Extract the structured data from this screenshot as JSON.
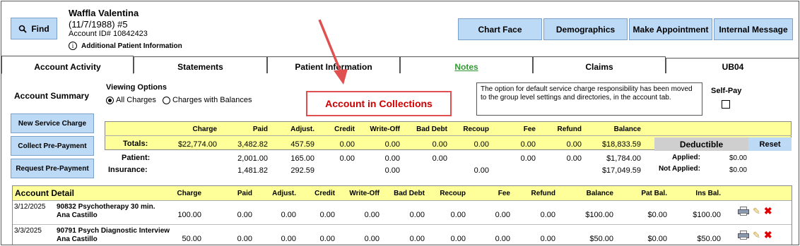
{
  "find_label": "Find",
  "patient": {
    "name": "Waffla Valentina",
    "dob_line": "(11/7/1988) #5",
    "account_id": "Account ID# 10842423",
    "additional_info": "Additional Patient Information"
  },
  "top_buttons": [
    "Chart Face",
    "Demographics",
    "Make Appointment",
    "Internal Message"
  ],
  "tabs": [
    "Account Activity",
    "Statements",
    "Patient Information",
    "Notes",
    "Claims",
    "UB04"
  ],
  "account_summary": "Account Summary",
  "viewing_options": {
    "title": "Viewing Options",
    "opt1": "All Charges",
    "opt2": "Charges with Balances",
    "selected": "All Charges"
  },
  "collections_banner": "Account in Collections",
  "notice": "The option for default service charge responsibility has been moved to the group level settings and directories, in the account tab.",
  "self_pay": "Self-Pay",
  "side_buttons": [
    "New Service Charge",
    "Collect Pre-Payment",
    "Request Pre-Payment"
  ],
  "summary": {
    "headers": [
      "Charge",
      "Paid",
      "Adjust.",
      "Credit",
      "Write-Off",
      "Bad Debt",
      "Recoup",
      "Fee",
      "Refund",
      "Balance"
    ],
    "totals_label": "Totals:",
    "totals": [
      "$22,774.00",
      "3,482.82",
      "457.59",
      "0.00",
      "0.00",
      "0.00",
      "0.00",
      "0.00",
      "0.00",
      "$18,833.59"
    ],
    "patient_label": "Patient:",
    "patient": [
      "",
      "2,001.00",
      "165.00",
      "0.00",
      "0.00",
      "0.00",
      "",
      "0.00",
      "0.00",
      "$1,784.00"
    ],
    "insurance_label": "Insurance:",
    "insurance": [
      "",
      "1,481.82",
      "292.59",
      "",
      "0.00",
      "",
      "0.00",
      "",
      "",
      "$17,049.59"
    ],
    "deductible": "Deductible",
    "reset": "Reset",
    "applied_label": "Applied:",
    "applied": "$0.00",
    "not_applied_label": "Not Applied:",
    "not_applied": "$0.00"
  },
  "detail": {
    "title": "Account Detail",
    "headers": [
      "Charge",
      "Paid",
      "Adjust.",
      "Credit",
      "Write-Off",
      "Bad Debt",
      "Recoup",
      "Fee",
      "Refund",
      "Balance",
      "Pat Bal.",
      "Ins Bal."
    ],
    "rows": [
      {
        "date": "3/12/2025",
        "desc": "90832 Psychotherapy 30 min.",
        "provider": "Ana Castillo",
        "vals": [
          "100.00",
          "0.00",
          "0.00",
          "0.00",
          "0.00",
          "0.00",
          "0.00",
          "0.00",
          "0.00",
          "$100.00",
          "$0.00",
          "$100.00"
        ]
      },
      {
        "date": "3/3/2025",
        "desc": "90791 Psych Diagnostic Interview",
        "provider": "Ana Castillo",
        "vals": [
          "50.00",
          "0.00",
          "0.00",
          "0.00",
          "0.00",
          "0.00",
          "0.00",
          "0.00",
          "0.00",
          "$50.00",
          "$0.00",
          "$50.00"
        ]
      }
    ]
  },
  "colors": {
    "button": "#bcd9f5",
    "yellow": "#ffff99",
    "banner_border": "#e05050",
    "banner_text": "#d00000",
    "arrow": "#e05050",
    "notes_link": "#339933"
  }
}
